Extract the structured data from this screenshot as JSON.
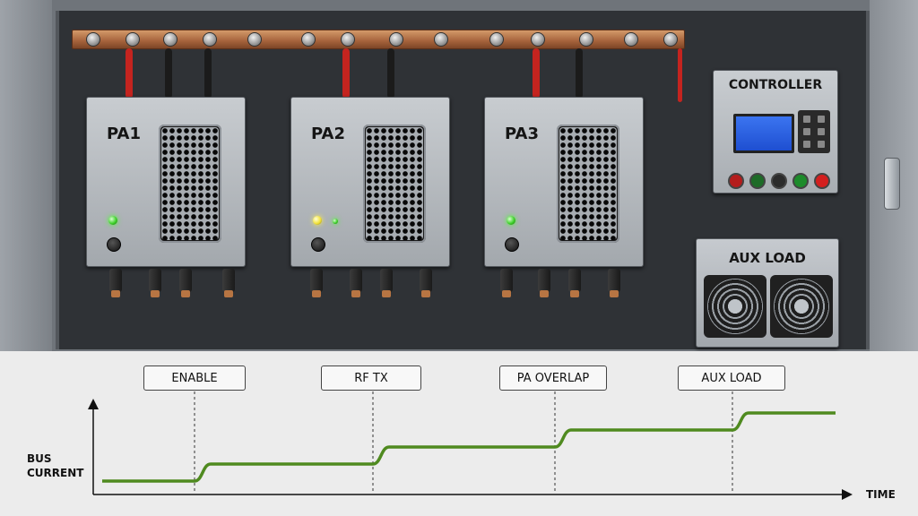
{
  "modules": [
    {
      "label": "PA1"
    },
    {
      "label": "PA2"
    },
    {
      "label": "PA3"
    }
  ],
  "controller": {
    "label": "CONTROLLER"
  },
  "aux_load": {
    "label": "AUX  LOAD"
  },
  "timeline": {
    "ylabel": "BUS\nCURRENT",
    "xlabel": "TIME",
    "events": [
      "ENABLE",
      "RF TX",
      "PA OVERLAP",
      "AUX LOAD"
    ]
  },
  "chart_data": {
    "type": "line",
    "xlabel": "TIME",
    "ylabel": "BUS CURRENT",
    "events": [
      "ENABLE",
      "RF TX",
      "PA OVERLAP",
      "AUX LOAD"
    ],
    "series": [
      {
        "values": [
          0,
          1,
          2,
          3,
          4
        ]
      }
    ],
    "series_color": "#4f8a1f"
  }
}
